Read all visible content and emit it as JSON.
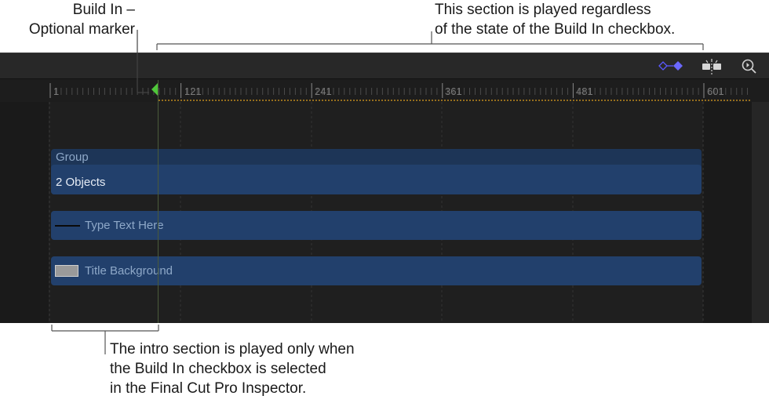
{
  "annotations": {
    "build_in_marker": [
      "Build In –",
      "Optional marker"
    ],
    "played_section": [
      "This section is played regardless",
      "of the state of the Build In checkbox."
    ],
    "intro_section": [
      "The intro section is played only when",
      "the Build In checkbox is selected",
      "in the Final Cut Pro Inspector."
    ]
  },
  "toolbar": {
    "icons": [
      "keyframe-toggle-icon",
      "snapping-icon",
      "zoom-icon"
    ],
    "accent_color": "#5a58ff"
  },
  "ruler": {
    "ticks": [
      "1",
      "121",
      "241",
      "361",
      "481",
      "601"
    ],
    "marker_color": "#4fc73a"
  },
  "tracks": {
    "group_label": "Group",
    "objects_label": "2 Objects",
    "layers": [
      {
        "label": "Type Text Here",
        "icon": "text-line-icon"
      },
      {
        "label": "Title Background",
        "icon": "thumbnail-icon"
      }
    ]
  }
}
